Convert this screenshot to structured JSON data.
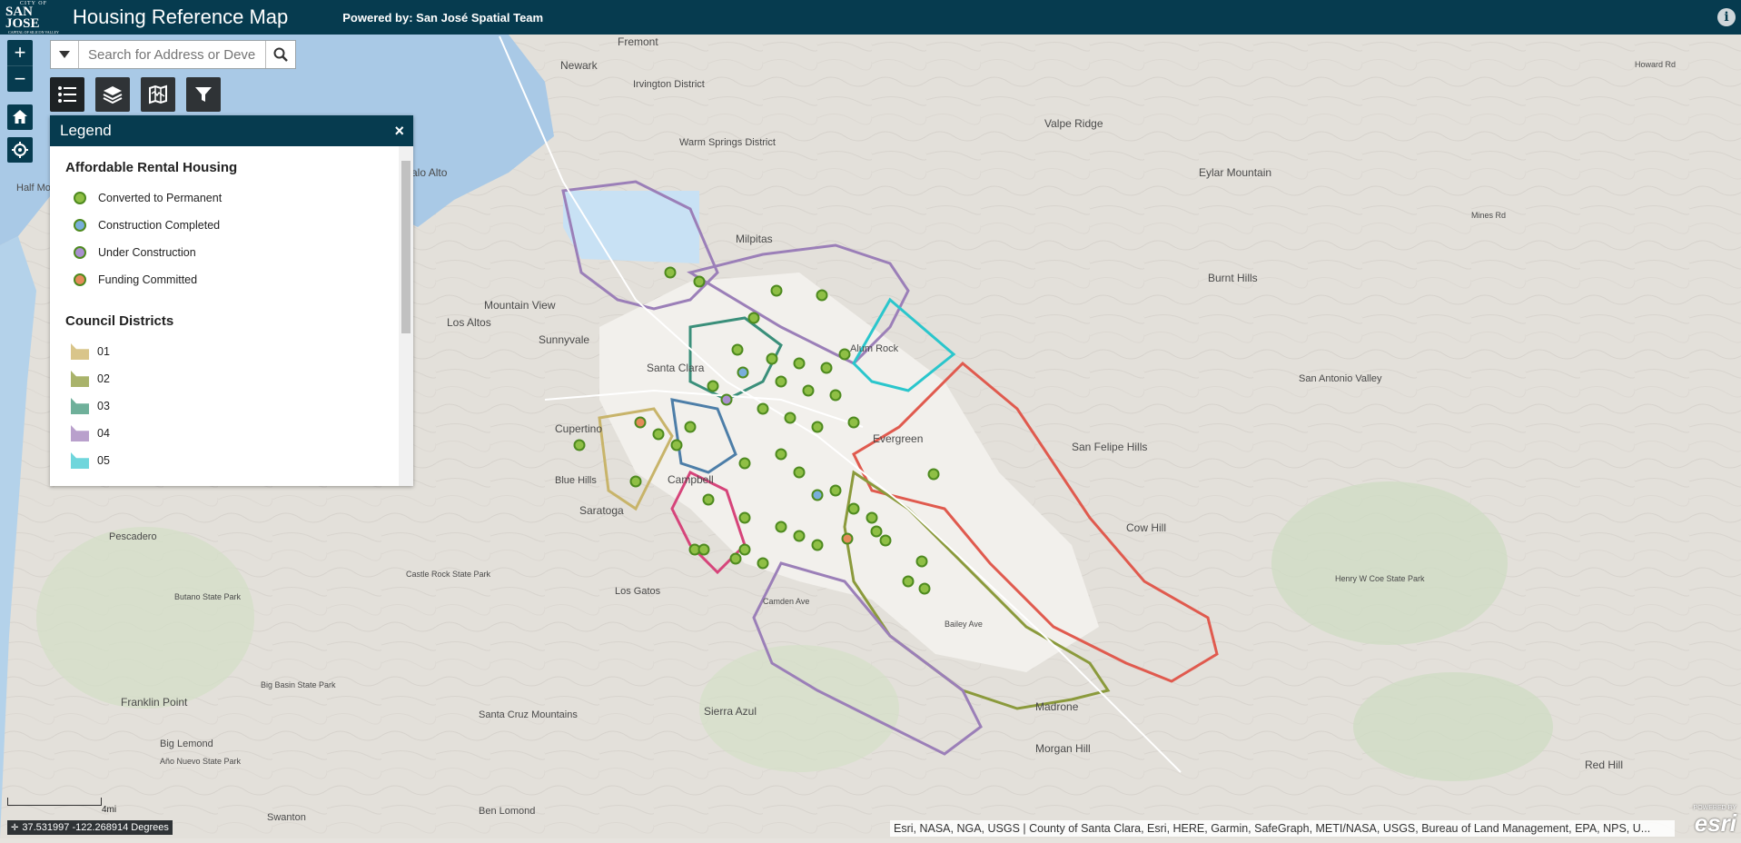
{
  "header": {
    "logo_top": "CITY OF",
    "logo_main": "SAN JOSE",
    "logo_sub": "CAPITAL OF SILICON VALLEY",
    "title": "Housing Reference Map",
    "powered_by": "Powered by: San José Spatial Team",
    "info_icon": "info-icon",
    "info_glyph": "i"
  },
  "colors": {
    "header_bg": "#063b4f",
    "district_01": "#c8b46a",
    "district_02": "#8b9a3c",
    "district_03": "#3a8f7a",
    "district_04": "#9b7fb8",
    "district_05": "#2ac6cc",
    "district_east": "#e05a4e"
  },
  "controls": {
    "zoom_in": "+",
    "zoom_out": "−",
    "home_icon": "home-icon",
    "locate_icon": "locate-icon"
  },
  "search": {
    "placeholder": "Search for Address or Devel",
    "value": ""
  },
  "toolbar": {
    "items": [
      "legend-list-icon",
      "layers-icon",
      "basemap-gallery-icon",
      "filter-icon"
    ]
  },
  "legend": {
    "title": "Legend",
    "close_glyph": "×",
    "section1_title": "Affordable Rental Housing",
    "statuses": [
      {
        "label": "Converted to Permanent",
        "fill": "#8fbf45"
      },
      {
        "label": "Construction Completed",
        "fill": "#79aedb"
      },
      {
        "label": "Under Construction",
        "fill": "#a98fcf"
      },
      {
        "label": "Funding Committed",
        "fill": "#e58b5a"
      }
    ],
    "section2_title": "Council Districts",
    "districts": [
      {
        "label": "01",
        "fill": "#d9c58a"
      },
      {
        "label": "02",
        "fill": "#a9b36b"
      },
      {
        "label": "03",
        "fill": "#6fb09a"
      },
      {
        "label": "04",
        "fill": "#b9a0cc"
      },
      {
        "label": "05",
        "fill": "#6fd6dc"
      }
    ]
  },
  "map_labels": [
    "Fremont",
    "Newark",
    "Irvington District",
    "Warm Springs District",
    "Palo Alto",
    "Half Moon Bay",
    "Mountain View",
    "Los Altos",
    "Sunnyvale",
    "Santa Clara",
    "Milpitas",
    "Cupertino",
    "Campbell",
    "Blue Hills",
    "Saratoga",
    "Los Gatos",
    "Evergreen",
    "Alum Rock",
    "Pescadero",
    "Butano State Park",
    "Castle Rock State Park",
    "Big Basin State Park",
    "Franklin Point",
    "Big Lemond",
    "Año Nuevo State Park",
    "Swanton",
    "Ben Lomond",
    "Sierra Azul",
    "Santa Cruz Mountains",
    "Madrone",
    "Morgan Hill",
    "Eylar Mountain",
    "Burnt Hills",
    "San Felipe Hills",
    "Cow Hill",
    "Henry W Coe State Park",
    "Red Hill",
    "Valpe Ridge",
    "San Antonio Valley",
    "Mines Rd",
    "Howard Rd",
    "Camden Ave",
    "Bailey Ave"
  ],
  "scale": {
    "label": "4mi"
  },
  "coordinates": {
    "text": "37.531997 -122.268914 Degrees",
    "icon": "crosshair-icon"
  },
  "attribution": "Esri, NASA, NGA, USGS | County of Santa Clara, Esri, HERE, Garmin, SafeGraph, METI/NASA, USGS, Bureau of Land Management, EPA, NPS, U...",
  "esri": {
    "powered": "POWERED BY",
    "word": "esri"
  }
}
